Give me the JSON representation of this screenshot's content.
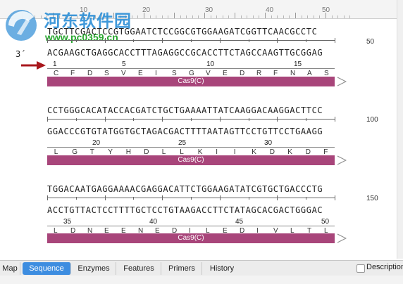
{
  "ruler": {
    "labels": [
      "10",
      "20",
      "30",
      "40",
      "50"
    ]
  },
  "watermark": {
    "title": "河东软件园",
    "url": "www.pc0359.cn",
    "logo_icon": "hedong-logo-icon",
    "brand_color": "#2c8fd6",
    "url_color": "#27a52e"
  },
  "rows": [
    {
      "top": "TGCTTCGACTCCGTGGAATCTCCGGCGTGGAAGATCGGTTCAACGCCTC",
      "bottom": "ACGAAGCTGAGGCACCTTTAGAGGCCGCACCTTCTAGCCAAGTTGCGGAG",
      "end": "50",
      "strand_label": "3´",
      "aa": [
        "C",
        "F",
        "D",
        "S",
        "V",
        "E",
        "I",
        "S",
        "G",
        "V",
        "E",
        "D",
        "R",
        "F",
        "N",
        "A",
        "S"
      ],
      "aa_nums": [
        "1",
        "5",
        "10",
        "15"
      ],
      "feature": "Cas9(C)"
    },
    {
      "top": "CCTGGGCACATACCACGATCTGCTGAAAATTATCAAGGACAAGGACTTCC",
      "bottom": "GGACCCGTGTATGGTGCTAGACGACTTTTAATAGTTCCTGTTCCTGAAGG",
      "end": "100",
      "aa": [
        "L",
        "G",
        "T",
        "Y",
        "H",
        "D",
        "L",
        "L",
        "K",
        "I",
        "I",
        "K",
        "D",
        "K",
        "D",
        "F"
      ],
      "aa_nums": [
        "20",
        "25",
        "30"
      ],
      "feature": "Cas9(C)"
    },
    {
      "top": "TGGACAATGAGGAAAACGAGGACATTCTGGAAGATATCGTGCTGACCCTG",
      "bottom": "ACCTGTTACTCCTTTTGCTCCTGTAAGACCTTCTATAGCACGACTGGGAC",
      "end": "150",
      "aa": [
        "L",
        "D",
        "N",
        "E",
        "E",
        "N",
        "E",
        "D",
        "I",
        "L",
        "E",
        "D",
        "I",
        "V",
        "L",
        "T",
        "L"
      ],
      "aa_nums": [
        "35",
        "40",
        "45",
        "50"
      ],
      "feature": "Cas9(C)"
    }
  ],
  "tabs": [
    {
      "label": "Map",
      "active": false
    },
    {
      "label": "Sequence",
      "active": true
    },
    {
      "label": "Enzymes",
      "active": false
    },
    {
      "label": "Features",
      "active": false
    },
    {
      "label": "Primers",
      "active": false
    },
    {
      "label": "History",
      "active": false
    }
  ],
  "descriptions_label": "Descriptions",
  "colors": {
    "feature": "#a8457a",
    "active_tab": "#3d8de0",
    "arrow": "#a8171c"
  }
}
